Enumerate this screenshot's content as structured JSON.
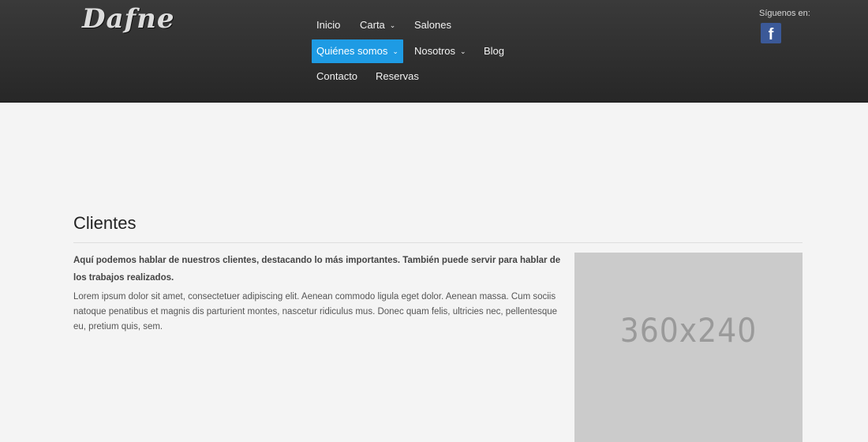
{
  "header": {
    "logo": "Dafne",
    "social_label": "Síguenos en:",
    "social_icon": "facebook-icon",
    "social_glyph": "f"
  },
  "nav": {
    "items": [
      {
        "label": "Inicio",
        "dropdown": false
      },
      {
        "label": "Carta",
        "dropdown": true
      },
      {
        "label": "Salones",
        "dropdown": false
      },
      {
        "label": "Quiénes somos",
        "dropdown": true,
        "active": true
      },
      {
        "label": "Nosotros",
        "dropdown": true
      },
      {
        "label": "Blog",
        "dropdown": false
      },
      {
        "label": "Contacto",
        "dropdown": false
      },
      {
        "label": "Reservas",
        "dropdown": false
      }
    ],
    "chevron": "⌄"
  },
  "colors": {
    "active_nav": "#1e9be4",
    "header_bg": "#2f2f2f",
    "facebook": "#3b5998"
  },
  "main": {
    "title": "Clientes",
    "lead": "Aquí podemos hablar de nuestros clientes, destacando lo más importantes. También puede servir para hablar de los trabajos realizados.",
    "body": "Lorem ipsum dolor sit amet, consectetuer adipiscing elit. Aenean commodo ligula eget dolor. Aenean massa. Cum sociis natoque penatibus et magnis dis parturient montes, nascetur ridiculus mus. Donec quam felis, ultricies nec, pellentesque eu, pretium quis, sem.",
    "image_placeholder": "360x240"
  }
}
